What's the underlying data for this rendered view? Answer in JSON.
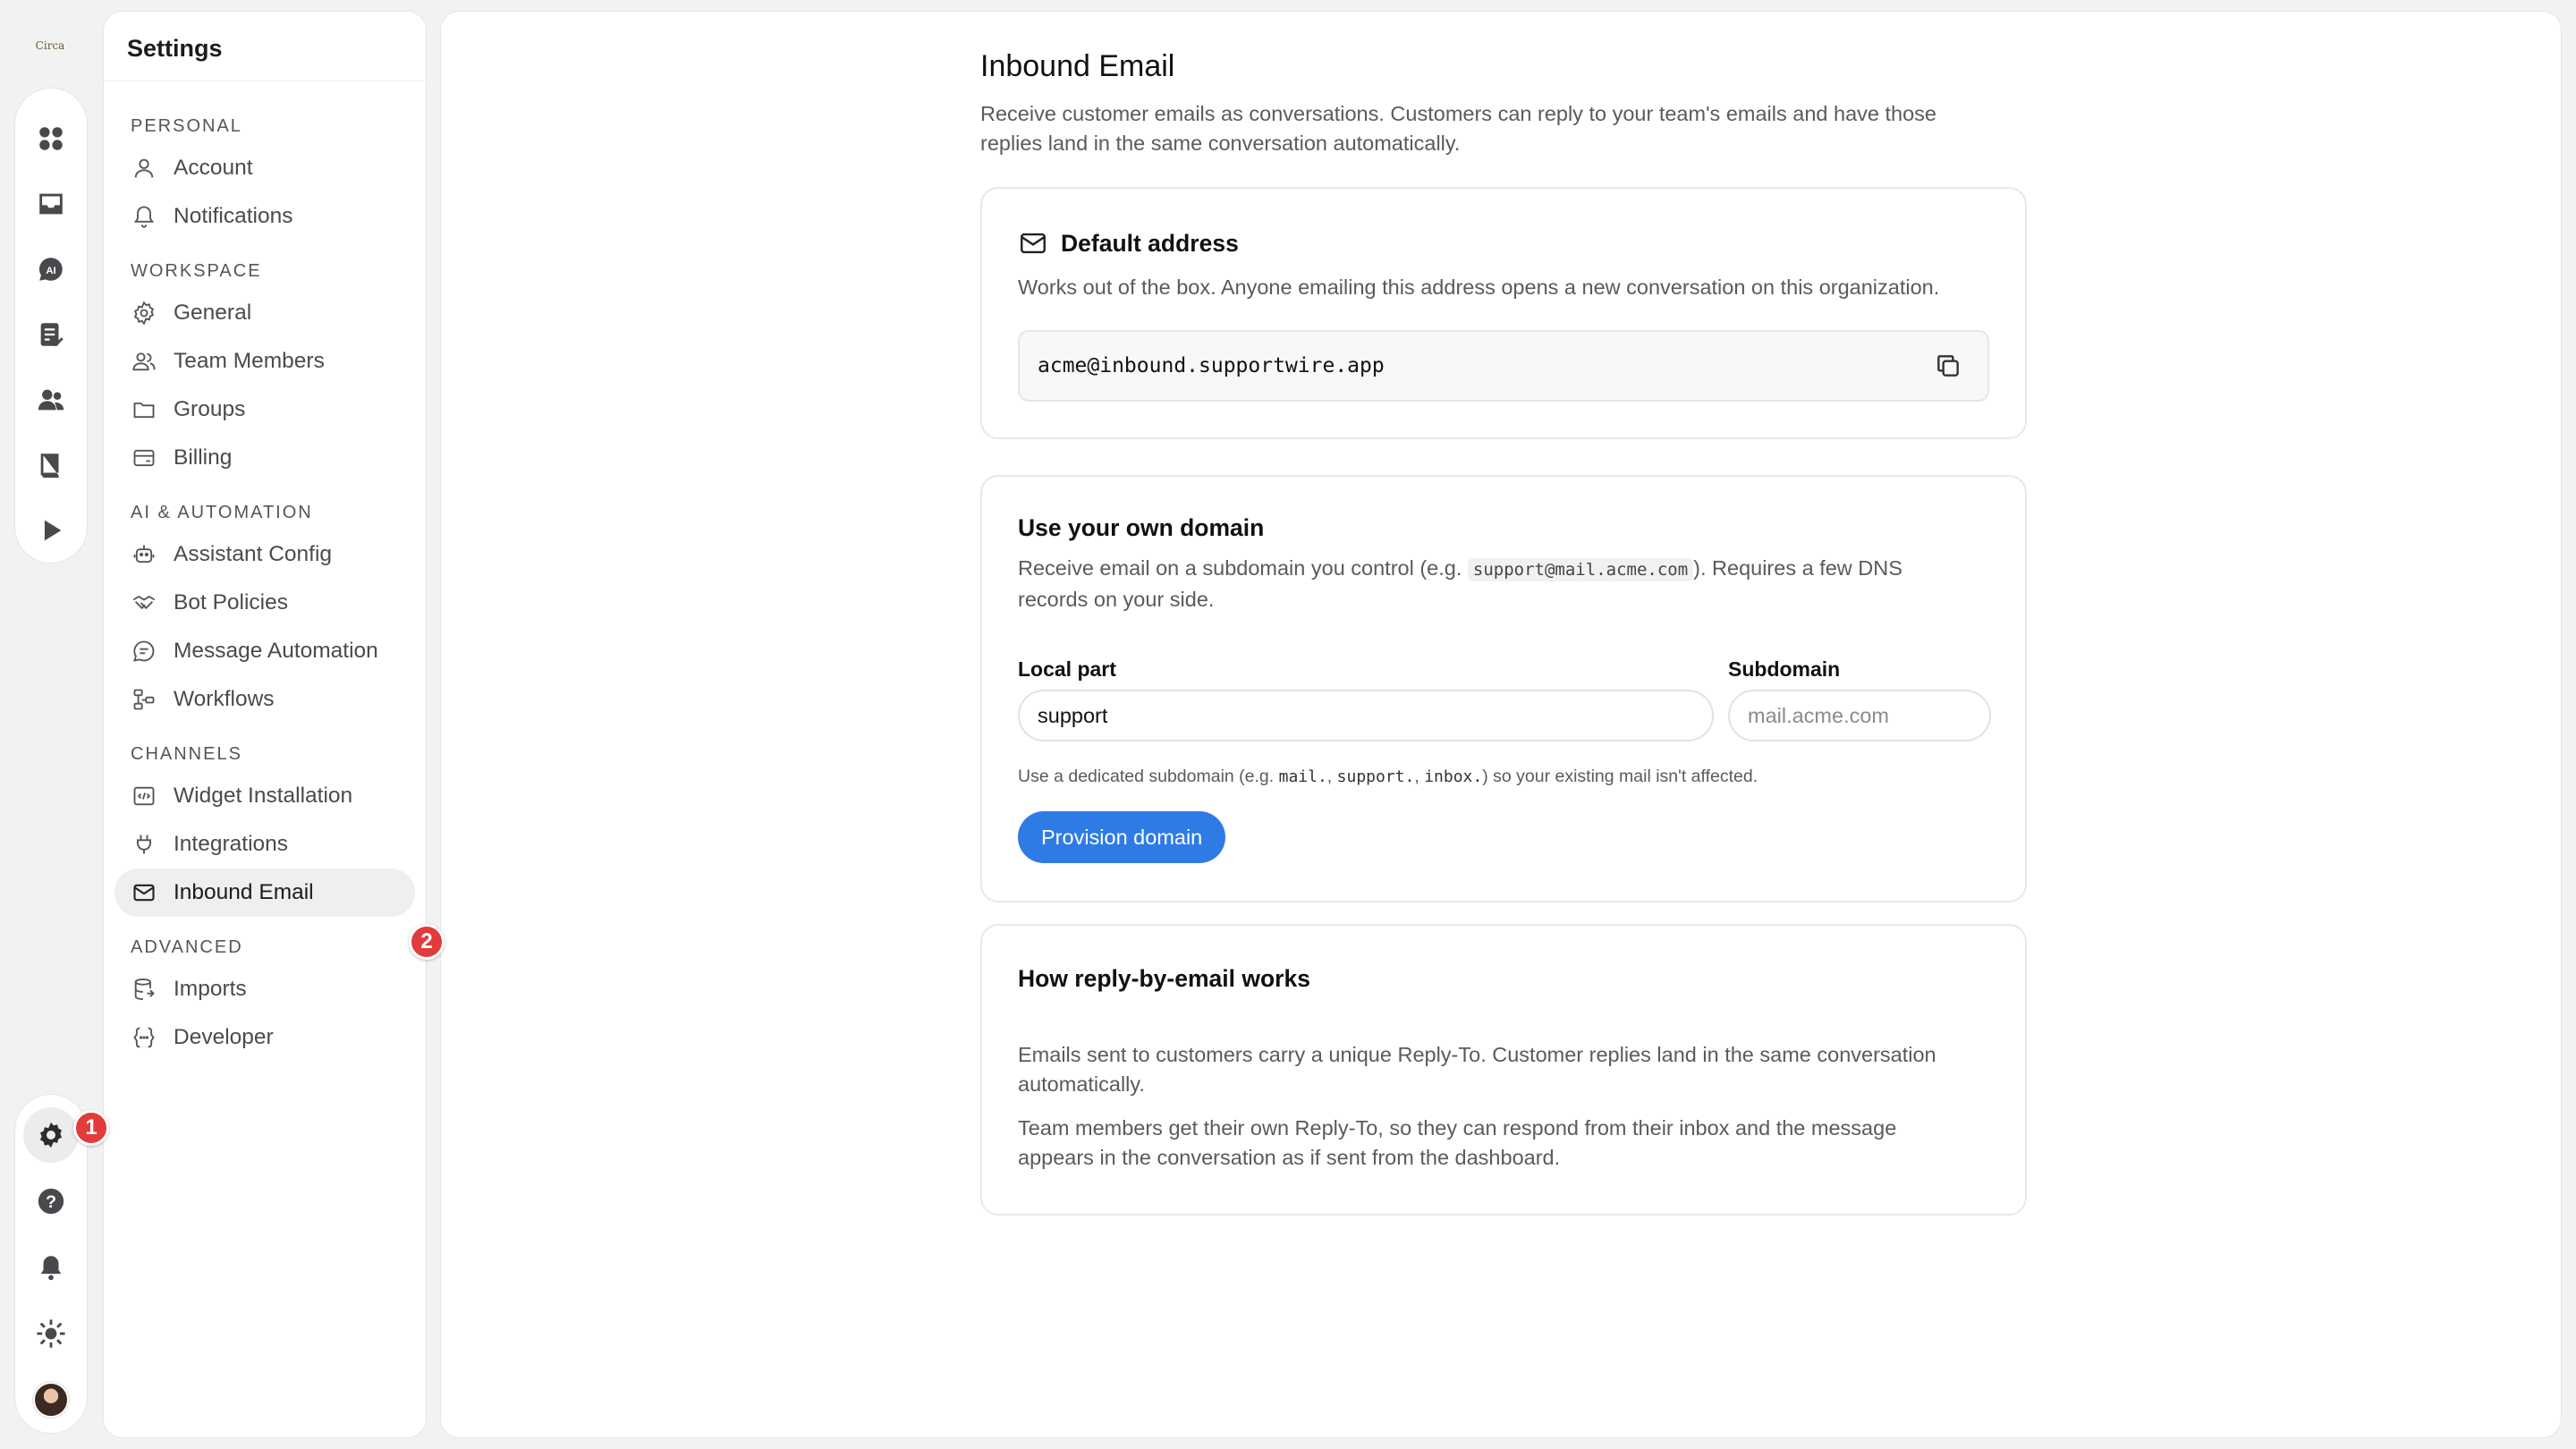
{
  "app": {
    "logo_text": "Circa"
  },
  "rail": {
    "top_icons": [
      "dashboard-icon",
      "inbox-icon",
      "ai-icon",
      "tasks-icon",
      "contacts-icon",
      "knowledge-book-icon",
      "play-icon"
    ],
    "bottom_icons": [
      "settings-gear-icon",
      "help-icon",
      "notifications-bell-icon",
      "theme-sun-icon"
    ]
  },
  "markers": {
    "one": "1",
    "two": "2"
  },
  "settings": {
    "title": "Settings",
    "sections": [
      {
        "label": "PERSONAL",
        "items": [
          {
            "label": "Account",
            "icon": "user-icon"
          },
          {
            "label": "Notifications",
            "icon": "bell-icon"
          }
        ]
      },
      {
        "label": "WORKSPACE",
        "items": [
          {
            "label": "General",
            "icon": "gear-icon"
          },
          {
            "label": "Team Members",
            "icon": "team-icon"
          },
          {
            "label": "Groups",
            "icon": "folder-icon"
          },
          {
            "label": "Billing",
            "icon": "card-icon"
          }
        ]
      },
      {
        "label": "AI & AUTOMATION",
        "items": [
          {
            "label": "Assistant Config",
            "icon": "robot-icon"
          },
          {
            "label": "Bot Policies",
            "icon": "handshake-icon"
          },
          {
            "label": "Message Automation",
            "icon": "chat-icon"
          },
          {
            "label": "Workflows",
            "icon": "workflow-icon"
          }
        ]
      },
      {
        "label": "CHANNELS",
        "items": [
          {
            "label": "Widget Installation",
            "icon": "code-icon"
          },
          {
            "label": "Integrations",
            "icon": "plug-icon"
          },
          {
            "label": "Inbound Email",
            "icon": "mail-icon",
            "active": true
          }
        ]
      },
      {
        "label": "ADVANCED",
        "items": [
          {
            "label": "Imports",
            "icon": "import-icon"
          },
          {
            "label": "Developer",
            "icon": "braces-icon"
          }
        ]
      }
    ]
  },
  "page": {
    "title": "Inbound Email",
    "description": "Receive customer emails as conversations. Customers can reply to your team's emails and have those replies land in the same conversation automatically."
  },
  "default_address": {
    "title": "Default address",
    "description": "Works out of the box. Anyone emailing this address opens a new conversation on this organization.",
    "address": "acme@inbound.supportwire.app"
  },
  "own_domain": {
    "title": "Use your own domain",
    "desc_before": "Receive email on a subdomain you control (e.g. ",
    "desc_code": "support@mail.acme.com",
    "desc_after": "). Requires a few DNS records on your side.",
    "local_part_label": "Local part",
    "local_part_value": "support",
    "subdomain_label": "Subdomain",
    "subdomain_placeholder": "mail.acme.com",
    "hint_1": "Use a dedicated subdomain (e.g. ",
    "hint_code_1": "mail.",
    "hint_sep_1": ", ",
    "hint_code_2": "support.",
    "hint_sep_2": ", ",
    "hint_code_3": "inbox.",
    "hint_2": ") so your existing mail isn't affected.",
    "button": "Provision domain"
  },
  "how_it_works": {
    "title": "How reply-by-email works",
    "paragraph_1": "Emails sent to customers carry a unique Reply-To. Customer replies land in the same conversation automatically.",
    "paragraph_2": "Team members get their own Reply-To, so they can respond from their inbox and the message appears in the conversation as if sent from the dashboard."
  }
}
